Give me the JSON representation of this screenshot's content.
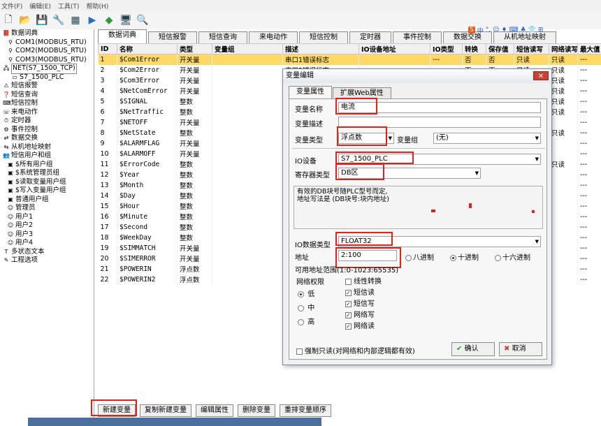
{
  "menu": [
    "文件(F)",
    "编辑(E)",
    "工具(T)",
    "帮助(H)"
  ],
  "tree": [
    {
      "label": "数据词典",
      "icon": "book-icon",
      "indent": 0
    },
    {
      "label": "COM1(MODBUS_RTU)",
      "icon": "plug-icon",
      "indent": 1
    },
    {
      "label": "COM2(MODBUS_RTU)",
      "icon": "plug-icon",
      "indent": 1
    },
    {
      "label": "COM3(MODBUS_RTU)",
      "icon": "plug-icon",
      "indent": 1
    },
    {
      "label": "NET(S7_1500_TCP)",
      "icon": "network-icon",
      "indent": 0
    },
    {
      "label": "S7_1500_PLC",
      "icon": "device-icon",
      "indent": 2
    },
    {
      "label": "短信报警",
      "icon": "alarm-icon",
      "indent": 0
    },
    {
      "label": "短信查询",
      "icon": "query-icon",
      "indent": 0
    },
    {
      "label": "短信控制",
      "icon": "control-icon",
      "indent": 0
    },
    {
      "label": "来电动作",
      "icon": "phone-icon",
      "indent": 0
    },
    {
      "label": "定时器",
      "icon": "clock-icon",
      "indent": 0
    },
    {
      "label": "事件控制",
      "icon": "event-icon",
      "indent": 0
    },
    {
      "label": "数据交换",
      "icon": "exchange-icon",
      "indent": 0
    },
    {
      "label": "从机地址映射",
      "icon": "map-icon",
      "indent": 0
    },
    {
      "label": "短信用户和组",
      "icon": "users-icon",
      "indent": 0
    },
    {
      "label": "$所有用户组",
      "icon": "group-icon",
      "indent": 1
    },
    {
      "label": "$系统管理员组",
      "icon": "group-icon",
      "indent": 1
    },
    {
      "label": "$读取变量用户组",
      "icon": "group-icon",
      "indent": 1
    },
    {
      "label": "$写入变量用户组",
      "icon": "group-icon",
      "indent": 1
    },
    {
      "label": "普通用户组",
      "icon": "group-icon",
      "indent": 1
    },
    {
      "label": "管理员",
      "icon": "user-icon",
      "indent": 1
    },
    {
      "label": "用户1",
      "icon": "user-icon",
      "indent": 1
    },
    {
      "label": "用户2",
      "icon": "user-icon",
      "indent": 1
    },
    {
      "label": "用户3",
      "icon": "user-icon",
      "indent": 1
    },
    {
      "label": "用户4",
      "icon": "user-icon",
      "indent": 1
    },
    {
      "label": "多状态文本",
      "icon": "text-icon",
      "indent": 0
    },
    {
      "label": "工程选项",
      "icon": "tool-icon",
      "indent": 0
    }
  ],
  "tabs": [
    "数据词典",
    "短信报警",
    "短信查询",
    "来电动作",
    "短信控制",
    "定时器",
    "事件控制",
    "数据交换",
    "从机地址映射"
  ],
  "columns": [
    "ID",
    "名称",
    "类型",
    "变量组",
    "描述",
    "IO设备地址",
    "IO类型",
    "转换",
    "保存值",
    "短信读写",
    "网络读写",
    "最大值"
  ],
  "rows": [
    [
      "1",
      "$Com1Error",
      "开关量",
      "",
      "串口1错误标志",
      "",
      "---",
      "否",
      "否",
      "只读",
      "只读",
      "---"
    ],
    [
      "2",
      "$Com2Error",
      "开关量",
      "",
      "串口2错误标志",
      "",
      "",
      "否",
      "否",
      "只读",
      "只读",
      "---"
    ],
    [
      "3",
      "$Com3Error",
      "开关量",
      "",
      "",
      "",
      "",
      "",
      "",
      "",
      "只读",
      "---"
    ],
    [
      "4",
      "$NetComError",
      "开关量",
      "",
      "",
      "",
      "",
      "",
      "",
      "",
      "只读",
      "---"
    ],
    [
      "5",
      "$SIGNAL",
      "整数",
      "",
      "",
      "",
      "",
      "",
      "",
      "",
      "只读",
      "---"
    ],
    [
      "6",
      "$NetTraffic",
      "整数",
      "",
      "",
      "",
      "",
      "",
      "",
      "",
      "只读",
      "---"
    ],
    [
      "7",
      "$NETOFF",
      "开关量",
      "",
      "",
      "",
      "",
      "",
      "",
      "",
      "",
      "---"
    ],
    [
      "8",
      "$NetState",
      "整数",
      "",
      "",
      "",
      "",
      "",
      "",
      "",
      "只读",
      "---"
    ],
    [
      "9",
      "$ALARMFLAG",
      "开关量",
      "",
      "",
      "",
      "",
      "",
      "",
      "",
      "",
      "---"
    ],
    [
      "10",
      "$ALARMOFF",
      "开关量",
      "",
      "",
      "",
      "",
      "",
      "",
      "",
      "",
      "---"
    ],
    [
      "11",
      "$ErrorCode",
      "整数",
      "",
      "",
      "",
      "",
      "",
      "",
      "",
      "只读",
      "---"
    ],
    [
      "12",
      "$Year",
      "整数",
      "",
      "",
      "",
      "",
      "",
      "",
      "",
      "",
      "---"
    ],
    [
      "13",
      "$Month",
      "整数",
      "",
      "",
      "",
      "",
      "",
      "",
      "",
      "",
      "---"
    ],
    [
      "14",
      "$Day",
      "整数",
      "",
      "",
      "",
      "",
      "",
      "",
      "",
      "",
      "---"
    ],
    [
      "15",
      "$Hour",
      "整数",
      "",
      "",
      "",
      "",
      "",
      "",
      "",
      "",
      "---"
    ],
    [
      "16",
      "$Minute",
      "整数",
      "",
      "",
      "",
      "",
      "",
      "",
      "",
      "",
      "---"
    ],
    [
      "17",
      "$Second",
      "整数",
      "",
      "",
      "",
      "",
      "",
      "",
      "",
      "",
      "---"
    ],
    [
      "18",
      "$WeekDay",
      "整数",
      "",
      "",
      "",
      "",
      "",
      "",
      "",
      "",
      "---"
    ],
    [
      "19",
      "$SIMMATCH",
      "开关量",
      "",
      "",
      "",
      "",
      "",
      "",
      "",
      "",
      "---"
    ],
    [
      "20",
      "$SIMERROR",
      "开关量",
      "",
      "",
      "",
      "",
      "",
      "",
      "",
      "",
      "---"
    ],
    [
      "21",
      "$POWERIN",
      "浮点数",
      "",
      "",
      "",
      "",
      "",
      "",
      "",
      "",
      "---"
    ],
    [
      "22",
      "$POWERIN2",
      "浮点数",
      "",
      "",
      "",
      "",
      "",
      "",
      "",
      "",
      "---"
    ]
  ],
  "bottom_buttons": [
    "新建变量",
    "复制新建变量",
    "编辑属性",
    "删除变量",
    "重排变量顺序"
  ],
  "dialog": {
    "title": "变量编辑",
    "close": "✕",
    "tabs": [
      "变量属性",
      "扩展Web属性"
    ],
    "name_label": "变量名称",
    "name_value": "电流",
    "desc_label": "变量描述",
    "desc_value": "",
    "type_label": "变量类型",
    "type_value": "浮点数",
    "group_label": "变量组",
    "group_value": "(无)",
    "io_label": "IO设备",
    "io_value": "S7_1500_PLC",
    "reg_label": "寄存器类型",
    "reg_value": "DB区",
    "note_line1": "有效的DB块号随PLC型号而定,",
    "note_line2": "地址写法是 (DB块号:块内地址)",
    "datatype_label": "IO数据类型",
    "datatype_value": "FLOAT32",
    "addr_label": "地址",
    "addr_value": "2:100",
    "radix": [
      "八进制",
      "十进制",
      "十六进制"
    ],
    "radix_selected": 1,
    "range_label": "可用地址范围",
    "range_value": "(1:0-1023:65535)",
    "perm_label": "网络权限",
    "perm": [
      "低",
      "中",
      "高"
    ],
    "perm_selected": 0,
    "checks": [
      {
        "label": "线性转换",
        "checked": false
      },
      {
        "label": "短信读",
        "checked": true
      },
      {
        "label": "短信写",
        "checked": true
      },
      {
        "label": "网络写",
        "checked": true
      },
      {
        "label": "网络读",
        "checked": true
      }
    ],
    "readonly_label": "强制只读(对网络和内部逻辑都有效)",
    "ok": "确认",
    "cancel": "取消"
  },
  "ime": [
    "S",
    "中",
    "°,",
    "☺",
    "♦",
    "⌨",
    "♣",
    "👕",
    "⊞"
  ]
}
